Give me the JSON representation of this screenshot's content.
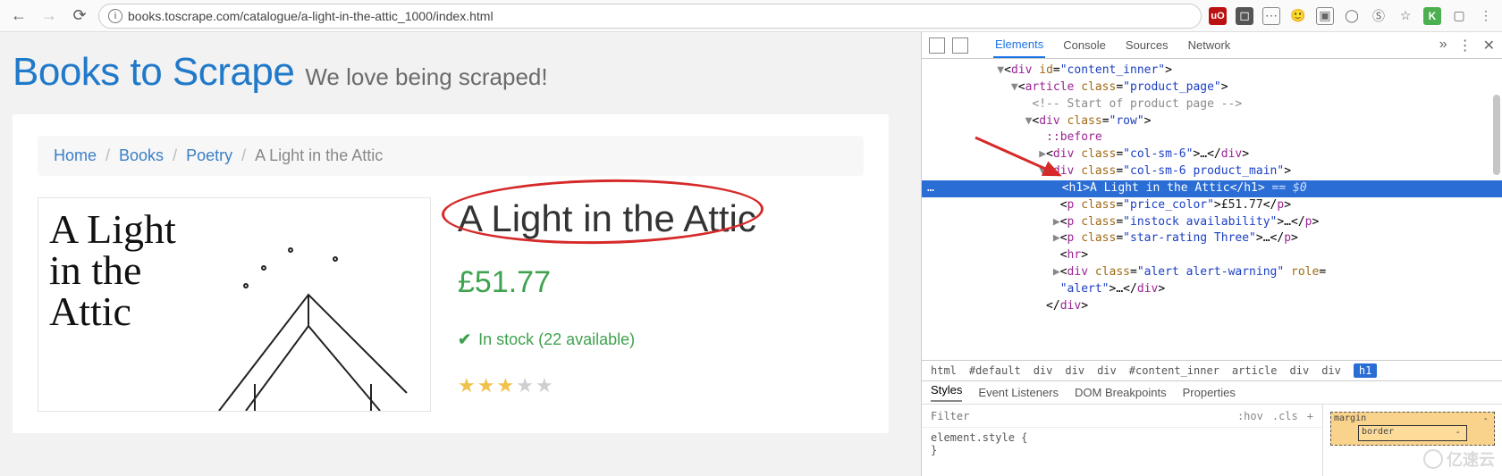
{
  "browser": {
    "url": "books.toscrape.com/catalogue/a-light-in-the-attic_1000/index.html",
    "ext_labels": {
      "ublock": "uO",
      "k": "K"
    }
  },
  "page": {
    "brand": "Books to Scrape",
    "tagline": "We love being scraped!",
    "breadcrumb": {
      "home": "Home",
      "books": "Books",
      "poetry": "Poetry",
      "current": "A Light in the Attic"
    },
    "product": {
      "title": "A Light in the Attic",
      "price": "£51.77",
      "stock": "In stock (22 available)",
      "rating": 3,
      "cover_title": "A Light in the Attic"
    }
  },
  "devtools": {
    "tabs": {
      "elements": "Elements",
      "console": "Console",
      "sources": "Sources",
      "network": "Network"
    },
    "close": "✕",
    "more": "»",
    "menu": "⋮",
    "dom": {
      "l1": "▼<div id=\"content_inner\">",
      "l2": "▼<article class=\"product_page\">",
      "l3": "<!-- Start of product page -->",
      "l4": "▼<div class=\"row\">",
      "l5": "::before",
      "l6": "▶<div class=\"col-sm-6\">…</div>",
      "l7": "▼<div class=\"col-sm-6 product_main\">",
      "l8_open": "<h1>",
      "l8_text": "A Light in the Attic",
      "l8_close": "</h1>",
      "l8_eq": " == $0",
      "l9": "<p class=\"price_color\">£51.77</p>",
      "l10": "▶<p class=\"instock availability\">…</p>",
      "l11": "▶<p class=\"star-rating Three\">…</p>",
      "l12": "<hr>",
      "l13": "▶<div class=\"alert alert-warning\" role=\"alert\">…</div>",
      "l14": "</div>"
    },
    "crumbs": [
      "html",
      "#default",
      "div",
      "div",
      "div",
      "#content_inner",
      "article",
      "div",
      "div",
      "h1"
    ],
    "styles_tabs": {
      "styles": "Styles",
      "listeners": "Event Listeners",
      "dom_bp": "DOM Breakpoints",
      "props": "Properties"
    },
    "filter_placeholder": "Filter",
    "filter_ctrls": {
      "hov": ":hov",
      "cls": ".cls",
      "plus": "+"
    },
    "rule_open": "element.style {",
    "rule_close": "}",
    "boxmodel": {
      "margin": "margin",
      "border": "border",
      "dash": "-"
    }
  },
  "watermark": "亿速云"
}
